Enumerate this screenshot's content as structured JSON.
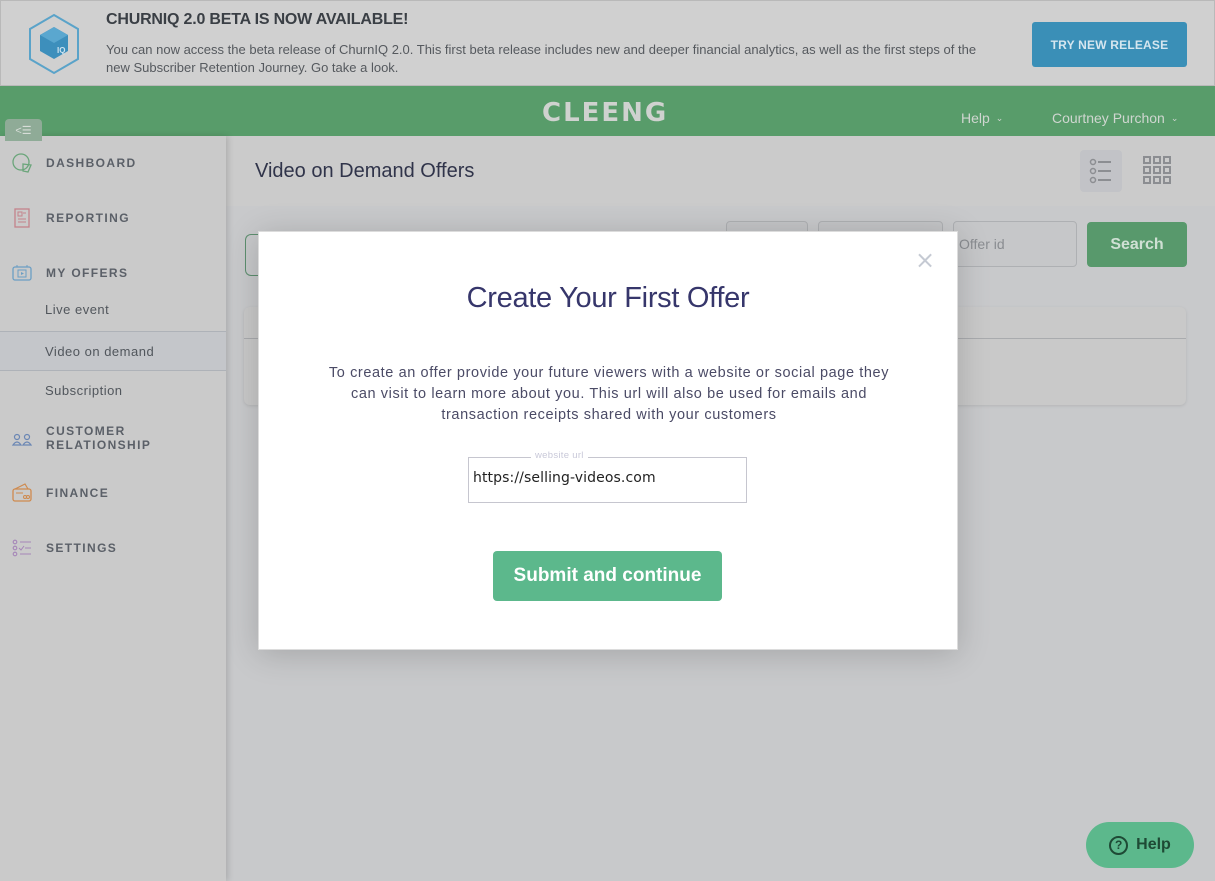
{
  "banner": {
    "title": "CHURNIQ 2.0 BETA IS NOW AVAILABLE!",
    "text": "You can now access the beta release of ChurnIQ 2.0. This first beta release includes new and deeper financial analytics, as well as the first steps of the new Subscriber Retention Journey. Go take a look.",
    "cta_label": "TRY NEW RELEASE",
    "logo_icon": "churniq-cube-icon",
    "accent_color": "#3a8fb7"
  },
  "header": {
    "brand": "CLEENG",
    "help_label": "Help",
    "user_name": "Courtney Purchon",
    "collapse_label": "<☰",
    "brand_color": "#589c6a"
  },
  "sidebar": {
    "items": [
      {
        "label": "DASHBOARD",
        "icon": "dashboard-pie-icon"
      },
      {
        "label": "REPORTING",
        "icon": "report-document-icon"
      },
      {
        "label": "MY OFFERS",
        "icon": "video-offers-icon"
      },
      {
        "label": "CUSTOMER RELATIONSHIP",
        "icon": "customers-icon"
      },
      {
        "label": "FINANCE",
        "icon": "finance-card-icon"
      },
      {
        "label": "SETTINGS",
        "icon": "settings-list-icon"
      }
    ],
    "offers_sub": [
      {
        "label": "Live event",
        "active": false
      },
      {
        "label": "Video on demand",
        "active": true
      },
      {
        "label": "Subscription",
        "active": false
      }
    ]
  },
  "main": {
    "title": "Video on Demand Offers",
    "view_list_icon": "list-view-icon",
    "view_grid_icon": "grid-view-icon",
    "offer_id_placeholder": "Offer id",
    "search_label": "Search"
  },
  "modal": {
    "close_label": "×",
    "title": "Create Your First Offer",
    "description": "To create an offer provide your future viewers with a website or social page they can visit to learn more about you. This url will also be used for emails and transaction receipts shared with your customers",
    "url_label": "website url",
    "url_value": "https://selling-videos.com",
    "submit_label": "Submit and continue",
    "submit_color": "#5cb88c"
  },
  "help_fab": {
    "label": "Help",
    "icon_glyph": "?"
  }
}
